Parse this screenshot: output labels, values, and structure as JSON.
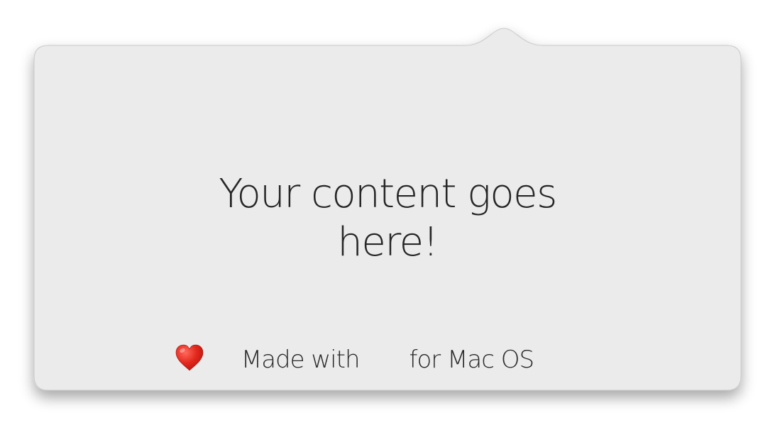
{
  "popover": {
    "heading": "Your content goes here!",
    "footer_prefix": "Made with",
    "footer_icon": "heart-icon",
    "footer_suffix": "for Mac OS"
  },
  "colors": {
    "panel_background": "#ebebeb",
    "panel_border": "#c9c9c9",
    "text": "#262626",
    "heart": "#e0281e"
  }
}
